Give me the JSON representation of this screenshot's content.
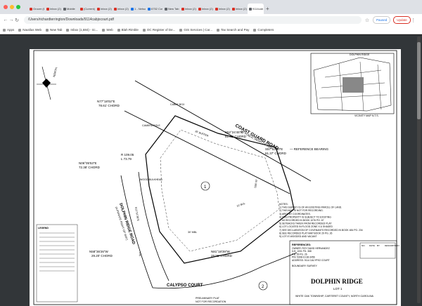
{
  "window": {
    "tabs": [
      {
        "label": "Grocer (6)",
        "color": "#d93025",
        "active": false
      },
      {
        "label": "Inbox (2)",
        "color": "#d93025",
        "active": false
      },
      {
        "label": "Mobile",
        "color": "#5f6368",
        "active": false
      },
      {
        "label": "(Current)",
        "color": "#d93025",
        "active": false
      },
      {
        "label": "Inbox (2)",
        "color": "#d93025",
        "active": false
      },
      {
        "label": "Inbox (2)",
        "color": "#d93025",
        "active": false
      },
      {
        "label": "1 - Nelson",
        "color": "#1a73e8",
        "active": false
      },
      {
        "label": "6752 Cos",
        "color": "#1a73e8",
        "active": false
      },
      {
        "label": "New Tab",
        "color": "#5f6368",
        "active": false
      },
      {
        "label": "Inbox (2)",
        "color": "#d93025",
        "active": false
      },
      {
        "label": "Inbox (2)",
        "color": "#d93025",
        "active": false
      },
      {
        "label": "Inbox (2)",
        "color": "#d93025",
        "active": false
      },
      {
        "label": "Inbox (2)",
        "color": "#d93025",
        "active": false
      },
      {
        "label": "9114cab",
        "color": "#5f6368",
        "active": true
      }
    ],
    "url": "/Users/richardterrington/Downloads/9114cabjocourt.pdf",
    "paused_label": "Paused",
    "update_label": "Update"
  },
  "bookmarks": [
    {
      "label": "Apps"
    },
    {
      "label": "Nautilus Web"
    },
    {
      "label": "New Tab"
    },
    {
      "label": "Inbox (1,684) - ric..."
    },
    {
      "label": "Web"
    },
    {
      "label": "Blah Rimble"
    },
    {
      "label": "OC Register of De..."
    },
    {
      "label": "GIS Services | Car..."
    },
    {
      "label": "Tax Search and Pay"
    },
    {
      "label": "Completers"
    }
  ],
  "survey": {
    "road_name": "COAST GUARD ROAD",
    "road_row": "60' PUBLIC RIGHT OF WAY",
    "ridge_road": "DOLPHIN RIDGE ROAD",
    "ridge_row": "(A PRIVATE RIGHT OF WAY)",
    "court": "CALYPSO COURT",
    "lot_number": "1",
    "neighbor_lot": "2",
    "north_label": "NORTH",
    "bearing_1": "N77°18'02\"E",
    "chord_1": "78.61' CHORD",
    "bearing_2": "S52°24'45\"E",
    "chord_2": "81.41' CHORD",
    "bearing_3": "S57°53'50\"E",
    "chord_3": "61.37' CHORD",
    "reference_bearing": "— REFERENCE BEARING",
    "bearing_4": "N06°05'53\"E",
    "chord_4": "72.38' CHORD",
    "radius_4": "R 109.05",
    "arc_4": "L 73.79",
    "bearing_5": "N58°36'26\"W",
    "chord_5": "29.20' CHORD",
    "bearing_6": "N81°18'39\"W",
    "chord_6": "29.95' CHORD",
    "buffer_label": "25' BUFFER",
    "vicinity_label": "VICINITY MAP  N.T.S.",
    "inset_title": "DOLPHIN RIDGE",
    "notes": [
      "NOTES:",
      "1) THIS SURVEY IS OF AN EXISTING PARCEL OF LAND.",
      "2) THIS MAP IS NOT FOR RECORDING.",
      "3) AREA BY COORDINATES.",
      "4) THIS PROPERTY IS SUBJECT TO EXISTING",
      "   ... AS RECORDED IN BOOK 1076 PG. 67",
      "5) SETBACKS TAKEN FROM RECORDED PLAT",
      "6) LOT LOCATED IN FLOOD ZONE X & SHADED",
      "7) SEE DECLARATION OF COVENANTS RECORDED IN BOOK 484 PG. 234",
      "8) SEE RECORDED PLAT MAP BOOK 29 PG. 26",
      "9) LOT IS WOODED AND VACANT"
    ],
    "references_label": "REFERENCES:",
    "reference_lines": [
      "OWNER: ROY DAVID HERNANDEZ",
      "D.B. 1001 PG. 368",
      "P.B. 29 PG. 26",
      "PIN: 5398-10-36-3456",
      "ADDRESS: 9114 CALYPSO COURT"
    ],
    "boundary_label": "BOUNDARY SURVEY",
    "title_project": "DOLPHIN RIDGE",
    "title_lot": "LOT 1",
    "title_location": "WHITE OAK TOWNSHIP, CARTERET COUNTY, NORTH CAROLINA",
    "revision_headers": [
      "NO.",
      "DATE",
      "BY",
      "DESCRIPTION"
    ],
    "legend_label": "LEGEND",
    "plat_label": "PRELIMINARY PLAT",
    "plat_sub": "NOT FOR RECORDATION",
    "bearing_left": "N12°51'38\"E",
    "label_camera": "CAMERA POLE",
    "label_cable": "CABLE BOX",
    "label_wood": "WOOD BULKHEAD",
    "small_a": "S58.76°",
    "small_b": "N7°",
    "dim_1": "10' BUL",
    "dim_2": "30' MBL"
  },
  "colors": {
    "chrome_bg": "#dee1e6",
    "viewer_bg": "#323639",
    "update_red": "#d93025",
    "paused_blue": "#1a73e8"
  }
}
